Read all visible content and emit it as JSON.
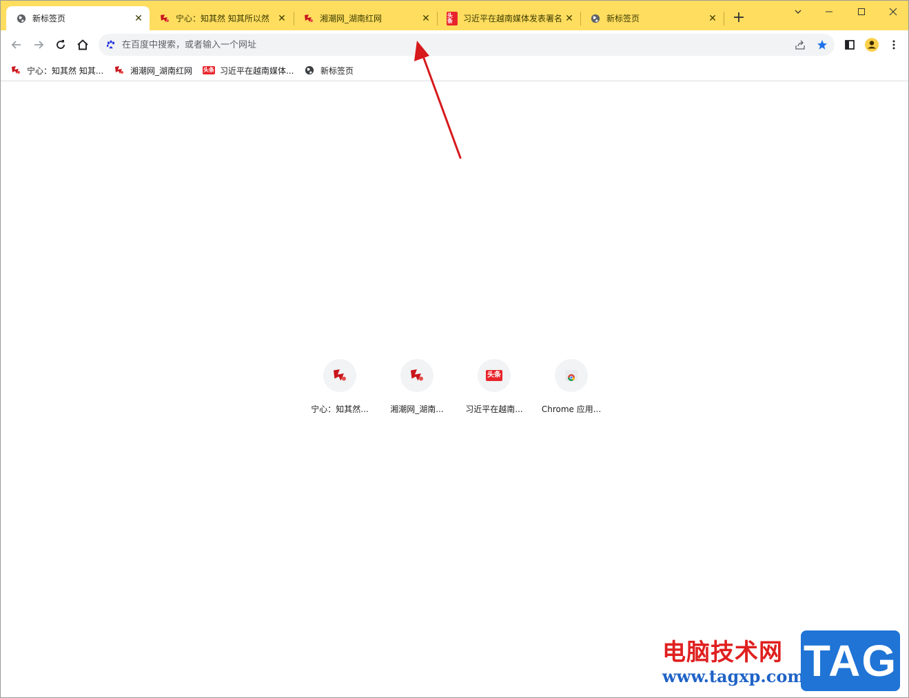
{
  "tabs": [
    {
      "title": "新标签页",
      "icon": "globe-icon",
      "active": true
    },
    {
      "title": "宁心：知其然 知其所以然",
      "icon": "rednet-icon",
      "active": false
    },
    {
      "title": "湘潮网_湖南红网",
      "icon": "rednet-icon",
      "active": false
    },
    {
      "title": "习近平在越南媒体发表署名",
      "icon": "toutiao-icon",
      "active": false
    },
    {
      "title": "新标签页",
      "icon": "globe-icon",
      "active": false
    }
  ],
  "tab_close_glyph": "✕",
  "new_tab_glyph": "+",
  "omnibox": {
    "placeholder": "在百度中搜索，或者输入一个网址",
    "search_engine_icon": "baidu-paw-icon"
  },
  "bookmarks": [
    {
      "label": "宁心：知其然 知其...",
      "icon": "rednet-icon"
    },
    {
      "label": "湘潮网_湖南红网",
      "icon": "rednet-icon"
    },
    {
      "label": "习近平在越南媒体...",
      "icon": "toutiao-icon"
    },
    {
      "label": "新标签页",
      "icon": "globe-icon"
    }
  ],
  "shortcuts": [
    {
      "label": "宁心：知其然...",
      "icon": "rednet-icon"
    },
    {
      "label": "湘潮网_湖南...",
      "icon": "rednet-icon"
    },
    {
      "label": "习近平在越南...",
      "icon": "toutiao-icon"
    },
    {
      "label": "Chrome 应用...",
      "icon": "chrome-apps-icon"
    }
  ],
  "toutiao_badge_text": "头条",
  "colors": {
    "tabstrip": "#fedd5f",
    "accent_blue": "#1a73e8",
    "arrow_red": "#d7191c"
  },
  "watermark": {
    "title": "电脑技术网",
    "url": "www.tagxp.com",
    "logo": "TAG"
  }
}
